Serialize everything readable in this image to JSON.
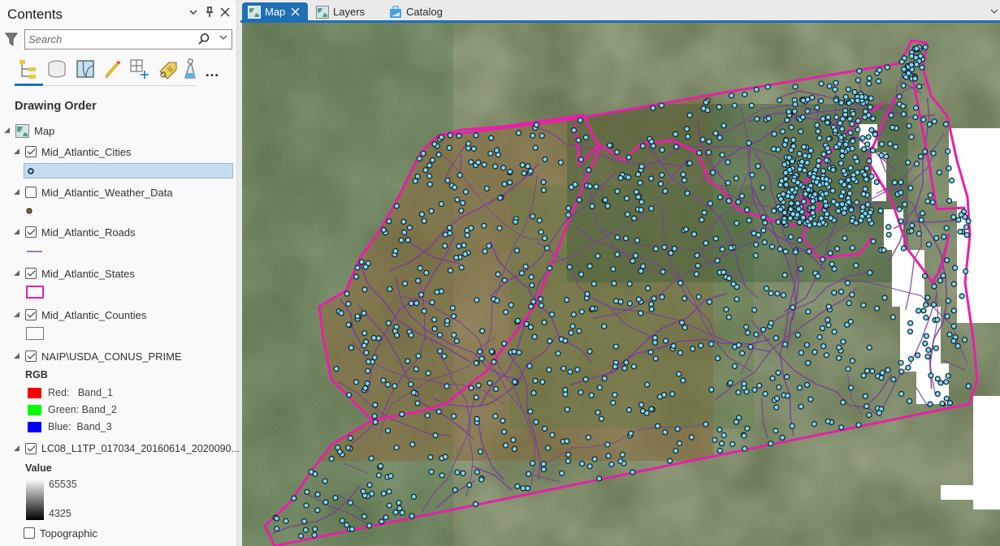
{
  "contents": {
    "title": "Contents",
    "controls": {
      "menu": "⌄",
      "pin": "📌",
      "close": "✕"
    },
    "search": {
      "placeholder": "Search",
      "value": ""
    },
    "toolbar_items": [
      "list-by-drawing-order",
      "list-by-data-source",
      "list-by-selection",
      "list-by-editing",
      "list-by-snapping",
      "list-by-labeling",
      "list-by-perspective-imagery"
    ],
    "more": "…",
    "section_title": "Drawing Order",
    "map_node": "Map",
    "layers": [
      {
        "name": "Mid_Atlantic_Cities",
        "checked": true,
        "symbol": "point-cyan",
        "selected_symbol": true
      },
      {
        "name": "Mid_Atlantic_Weather_Data",
        "checked": false,
        "symbol": "point-brown"
      },
      {
        "name": "Mid_Atlantic_Roads",
        "checked": true,
        "symbol": "line-purple"
      },
      {
        "name": "Mid_Atlantic_States",
        "checked": true,
        "symbol": "polygon-magenta"
      },
      {
        "name": "Mid_Atlantic_Counties",
        "checked": true,
        "symbol": "polygon-gray"
      },
      {
        "name": "NAIP\\USDA_CONUS_PRIME",
        "checked": true,
        "symbol": "rgb"
      },
      {
        "name": "LC08_L1TP_017034_20160614_2020090...",
        "checked": true,
        "symbol": "stretch"
      },
      {
        "name": "Topographic",
        "checked": false,
        "symbol": "none"
      }
    ],
    "rgb": {
      "heading": "RGB",
      "bands": [
        {
          "label": "Red:   Band_1",
          "color": "#ff0000"
        },
        {
          "label": "Green: Band_2",
          "color": "#00ff00"
        },
        {
          "label": "Blue:  Band_3",
          "color": "#0000ff"
        }
      ]
    },
    "stretch": {
      "heading": "Value",
      "high": "65535",
      "low": "4325"
    }
  },
  "tabs": [
    {
      "label": "Map",
      "active": true,
      "closable": true,
      "icon": "map-icon"
    },
    {
      "label": "Layers",
      "active": false,
      "icon": "map-icon"
    },
    {
      "label": "Catalog",
      "active": false,
      "icon": "catalog-icon"
    }
  ],
  "colors": {
    "accent": "#1f6fb7",
    "state_boundary": "#e81fa8",
    "roads": "#7a3f95",
    "city_fill": "#7fd8f2",
    "city_stroke": "#10202a",
    "selected_row": "#c5dcf0"
  }
}
